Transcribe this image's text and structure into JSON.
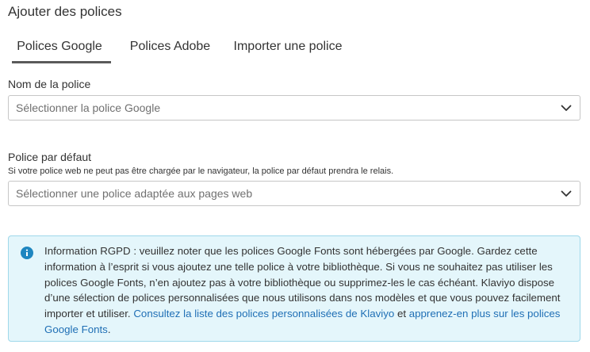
{
  "page": {
    "title": "Ajouter des polices"
  },
  "tabs": [
    {
      "label": "Polices Google",
      "active": true
    },
    {
      "label": "Polices Adobe",
      "active": false
    },
    {
      "label": "Importer une police",
      "active": false
    }
  ],
  "font_name": {
    "label": "Nom de la police",
    "placeholder": "Sélectionner la police Google"
  },
  "default_font": {
    "label": "Police par défaut",
    "helper": "Si votre police web ne peut pas être chargée par le navigateur, la police par défaut prendra le relais.",
    "placeholder": "Sélectionner une police adaptée aux pages web"
  },
  "gdpr_notice": {
    "text_before": "Information RGPD : veuillez noter que les polices Google Fonts sont hébergées par Google. Gardez cette information à l’esprit si vous ajoutez une telle police à votre bibliothèque. Si vous ne souhaitez pas utiliser les polices Google Fonts, n’en ajoutez pas à votre bibliothèque ou supprimez-les le cas échéant. Klaviyo dispose d’une sélection de polices personnalisées que nous utilisons dans nos modèles et que vous pouvez facilement importer et utiliser. ",
    "link1": "Consultez la liste des polices personnalisées de Klaviyo",
    "text_middle": " et ",
    "link2": "apprenez-en plus sur les polices Google Fonts",
    "text_after": "."
  },
  "colors": {
    "link": "#1f6fb5",
    "info_background": "#e4f6fb",
    "info_border": "#9fd8ea",
    "info_icon": "#1e86c0",
    "active_tab_underline": "#5a5a5a"
  },
  "icons": {
    "info": "info-icon",
    "dropdown": "chevron-down-icon"
  }
}
